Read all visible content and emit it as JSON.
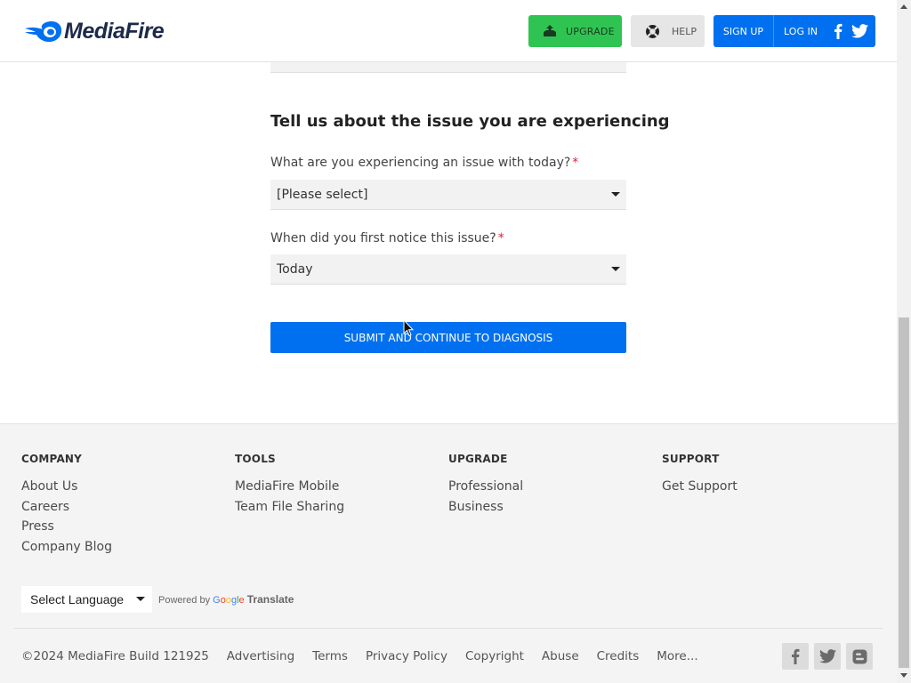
{
  "header": {
    "logo_text": "MediaFire",
    "upgrade_label": "UPGRADE",
    "help_label": "HELP",
    "signup_label": "SIGN UP",
    "login_label": "LOG IN"
  },
  "form": {
    "section_title": "Tell us about the issue you are experiencing",
    "q1": {
      "label": "What are you experiencing an issue with today?",
      "required": "*",
      "value": "[Please select]"
    },
    "q2": {
      "label": "When did you first notice this issue?",
      "required": "*",
      "value": "Today"
    },
    "submit_label": "SUBMIT AND CONTINUE TO DIAGNOSIS"
  },
  "footer": {
    "columns": [
      {
        "heading": "COMPANY",
        "links": [
          "About Us",
          "Careers",
          "Press",
          "Company Blog"
        ]
      },
      {
        "heading": "TOOLS",
        "links": [
          "MediaFire Mobile",
          "Team File Sharing"
        ]
      },
      {
        "heading": "UPGRADE",
        "links": [
          "Professional",
          "Business"
        ]
      },
      {
        "heading": "SUPPORT",
        "links": [
          "Get Support"
        ]
      }
    ],
    "language_select": "Select Language",
    "powered_by": "Powered by",
    "google": [
      "G",
      "o",
      "o",
      "g",
      "l",
      "e"
    ],
    "translate": "Translate",
    "copyright": "©2024 MediaFire Build 121925",
    "bottom_links": [
      "Advertising",
      "Terms",
      "Privacy Policy",
      "Copyright",
      "Abuse",
      "Credits",
      "More..."
    ]
  },
  "colors": {
    "brand_blue": "#0070f0",
    "upgrade_green": "#2fc452",
    "required_red": "#dd2233"
  },
  "icons": [
    "mediafire-logo-icon",
    "upgrade-icon",
    "lifebuoy-icon",
    "facebook-icon",
    "twitter-icon",
    "blogger-icon",
    "caret-down-icon",
    "mouse-cursor-icon"
  ]
}
